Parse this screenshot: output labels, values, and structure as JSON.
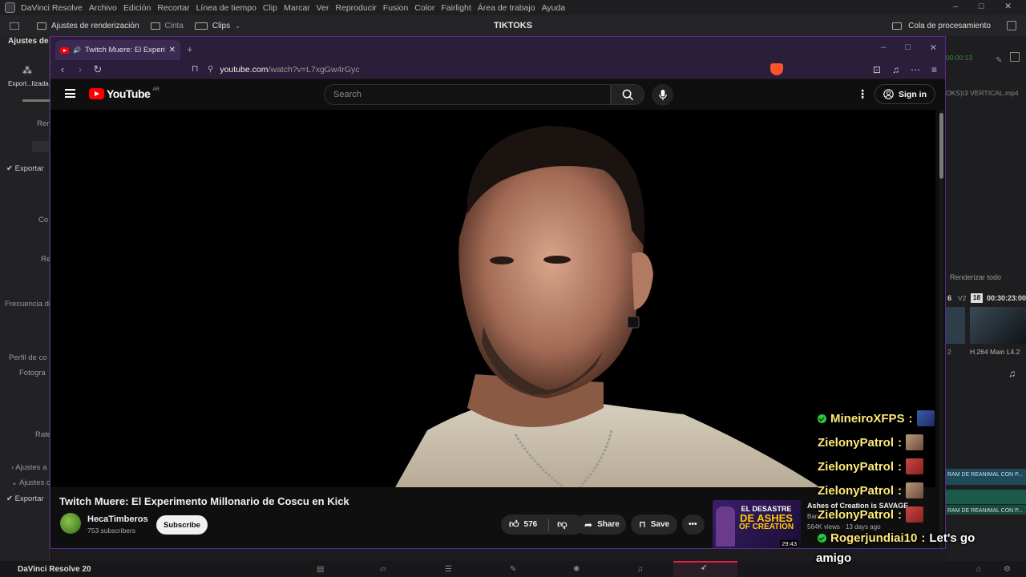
{
  "resolve_menu": {
    "app": "DaVinci Resolve",
    "items": [
      "Archivo",
      "Edición",
      "Recortar",
      "Línea de tiempo",
      "Clip",
      "Marcar",
      "Ver",
      "Reproducir",
      "Fusion",
      "Color",
      "Fairlight",
      "Área de trabajo",
      "Ayuda"
    ]
  },
  "resolve_toolbar": {
    "render_settings": "Ajustes de renderización",
    "tape": "Cinta",
    "clips": "Clips",
    "project_title": "TIKTOKS",
    "render_queue": "Cola de procesamiento"
  },
  "left_panel": {
    "header": "Ajustes de r",
    "export_label": "Export...lizada",
    "labels": [
      "Ren",
      "Exportar",
      "Co",
      "Re",
      "Frecuencia de",
      "Perfil de co",
      "Fotogra",
      "Rate",
      "Ajustes a",
      "Ajustes c",
      "Exportar"
    ]
  },
  "right_panel": {
    "timecode": "00:00:13",
    "file": "OKS)\\3 VERTICAL.mp4",
    "render_all": "Renderizar todo",
    "job_num": "18",
    "job_time": "00:30:23:00",
    "job_codec": "H.264 Main L4.2",
    "v_label": "V2",
    "clip1": "RAM DE REANIMAL CON P...",
    "clip2": "RAM DE REANIMAL CON P..."
  },
  "bottom_bar": {
    "app": "DaVinci Resolve 20"
  },
  "browser": {
    "tab_title": "Twitch Muere: El Experimento",
    "new_tab": "+",
    "url_domain": "youtube.com",
    "url_path": "/watch?v=L7xgGw4rGyc"
  },
  "youtube": {
    "logo_text": "YouTube",
    "country": "AR",
    "search_placeholder": "Search",
    "sign_in": "Sign in",
    "video_title": "Twitch Muere: El Experimento Millonario de Coscu en Kick",
    "channel": "HecaTimberos",
    "subscribers": "753 subscribers",
    "subscribe": "Subscribe",
    "likes": "576",
    "share": "Share",
    "save": "Save",
    "rec_thumb_line1": "EL DESASTRE",
    "rec_thumb_line2": "DE ASHES",
    "rec_thumb_line3": "OF CREATION",
    "rec_duration": "29:43",
    "rec_title": "Ashes of Creation is SAVAGE",
    "rec_channel": "Ban...",
    "rec_meta": "564K views · 13 days ago"
  },
  "chat": [
    {
      "user": "MineiroXFPS",
      "msg": ""
    },
    {
      "user": "ZielonyPatrol",
      "msg": ""
    },
    {
      "user": "ZielonyPatrol",
      "msg": ""
    },
    {
      "user": "ZielonyPatrol",
      "msg": ""
    },
    {
      "user": "ZielonyPatrol",
      "msg": ""
    },
    {
      "user": "Rogerjundiai10",
      "msg": "Let's go"
    },
    {
      "user": "",
      "msg": "amigo"
    }
  ]
}
